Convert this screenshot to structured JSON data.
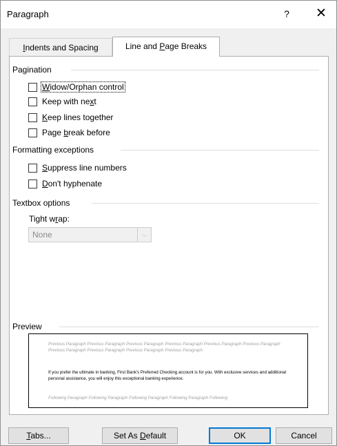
{
  "dialog": {
    "title": "Paragraph",
    "help_label": "?",
    "close_label": "✕"
  },
  "tabs": [
    {
      "label": "Indents and Spacing",
      "mnemonic": "I",
      "active": false
    },
    {
      "label": "Line and Page Breaks",
      "mnemonic": "P",
      "active": true
    }
  ],
  "pagination": {
    "header": "Pagination",
    "items": [
      {
        "label": "Widow/Orphan control",
        "mnemonic": "W",
        "checked": false,
        "focused": true
      },
      {
        "label": "Keep with next",
        "mnemonic": "x",
        "checked": false
      },
      {
        "label": "Keep lines together",
        "mnemonic": "K",
        "checked": false
      },
      {
        "label": "Page break before",
        "mnemonic": "b",
        "checked": false
      }
    ]
  },
  "formatting_exceptions": {
    "header": "Formatting exceptions",
    "items": [
      {
        "label": "Suppress line numbers",
        "mnemonic": "S",
        "checked": false
      },
      {
        "label": "Don't hyphenate",
        "mnemonic": "D",
        "checked": false
      }
    ]
  },
  "textbox_options": {
    "header": "Textbox options",
    "tight_wrap_label": "Tight wrap:",
    "tight_wrap_mnemonic": "r",
    "tight_wrap_value": "None",
    "disabled": true
  },
  "preview": {
    "header": "Preview",
    "previous_text": "Previous Paragraph Previous Paragraph Previous Paragraph Previous Paragraph Previous Paragraph Previous Paragraph Previous Paragraph Previous Paragraph Previous Paragraph Previous Paragraph",
    "sample_text": "If you prefer the ultimate in banking, First Bank's Preferred Checking account is for you. With exclusive services and additional personal assistance, you will enjoy this exceptional banking experience.",
    "following_text": "Following Paragraph Following Paragraph Following Paragraph Following Paragraph Following"
  },
  "buttons": {
    "tabs_label": "Tabs...",
    "tabs_mnemonic": "T",
    "set_default_label": "Set As Default",
    "set_default_mnemonic": "D",
    "ok_label": "OK",
    "cancel_label": "Cancel"
  },
  "colors": {
    "default_button_border": "#0078d7",
    "panel_background": "#ffffff",
    "dialog_background": "#f0f0f0"
  }
}
